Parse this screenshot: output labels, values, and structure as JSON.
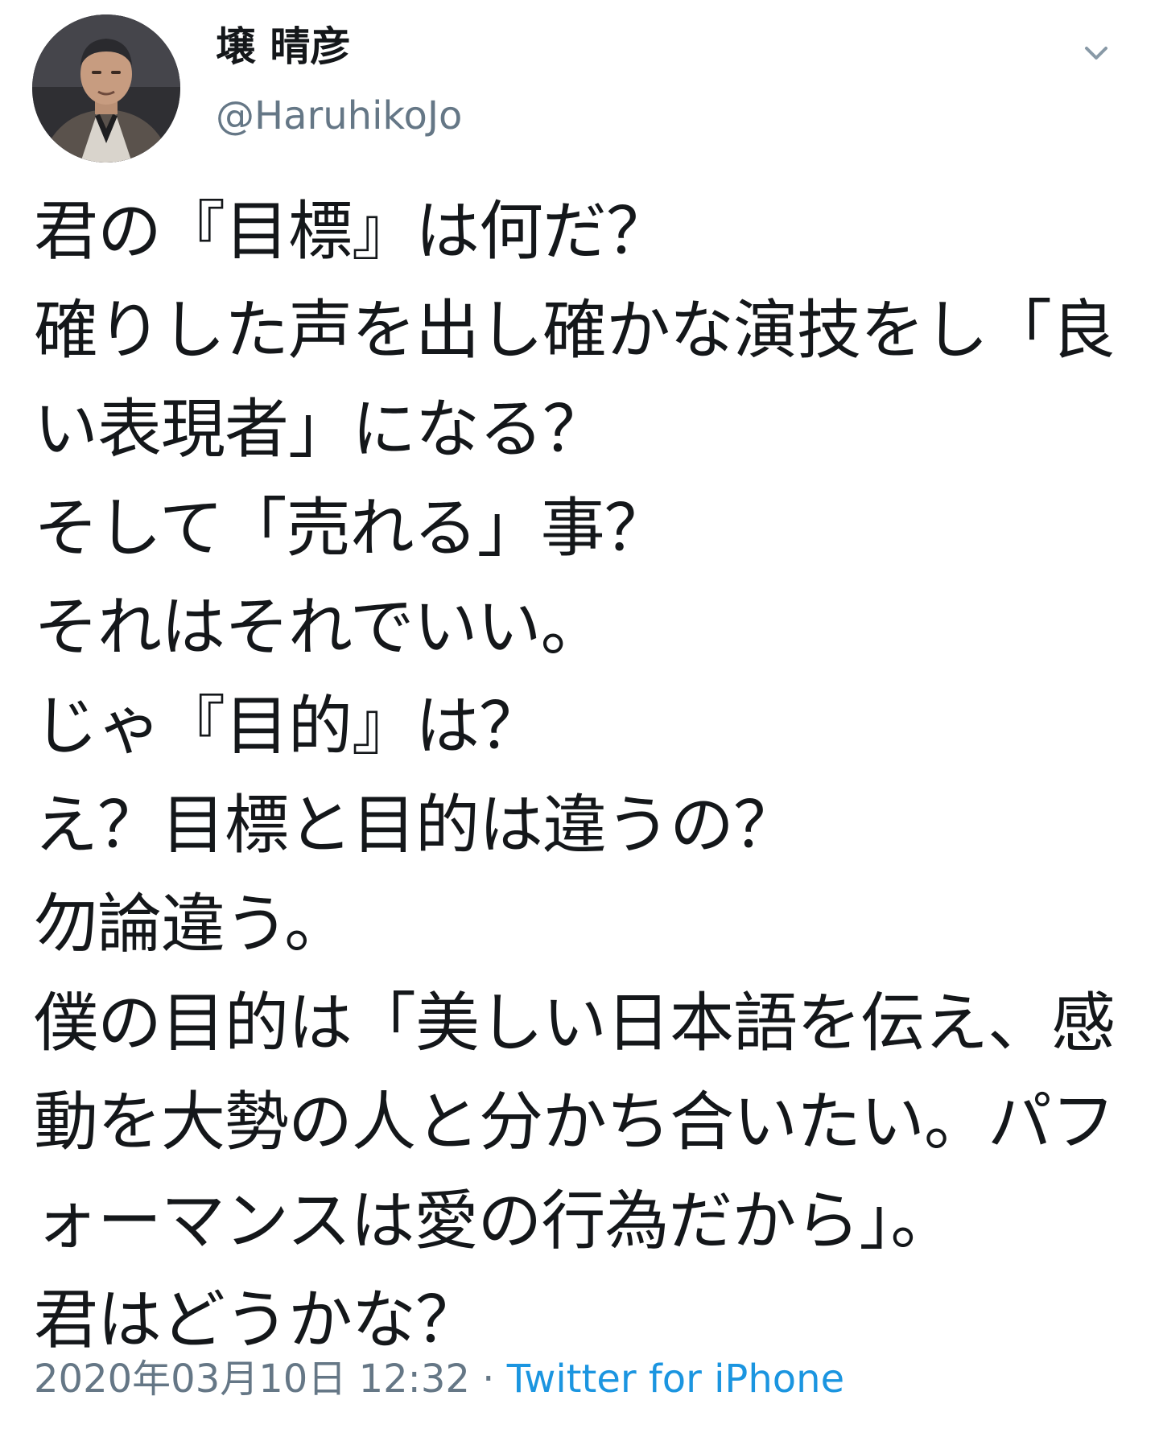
{
  "tweet": {
    "author": {
      "display_name": "壌 晴彦",
      "handle": "@HaruhikoJo",
      "avatar_icon": "user-avatar"
    },
    "menu_icon": "chevron-down-icon",
    "lines": [
      "君の『目標』は何だ？",
      "確りした声を出し確かな演技をし「良",
      "い表現者」になる？",
      "そして「売れる」事？",
      "それはそれでいい。",
      "じゃ『目的』は？",
      "え？目標と目的は違うの？",
      "勿論違う。",
      "僕の目的は「美しい日本語を伝え、感",
      "動を大勢の人と分かち合いたい。パフ",
      "ォーマンスは愛の行為だから」。",
      "君はどうかな？"
    ],
    "timestamp": "2020年03月10日 12:32",
    "separator": "·",
    "source": "Twitter for iPhone",
    "colors": {
      "text": "#14171a",
      "secondary": "#657786",
      "link": "#1b95e0"
    }
  }
}
